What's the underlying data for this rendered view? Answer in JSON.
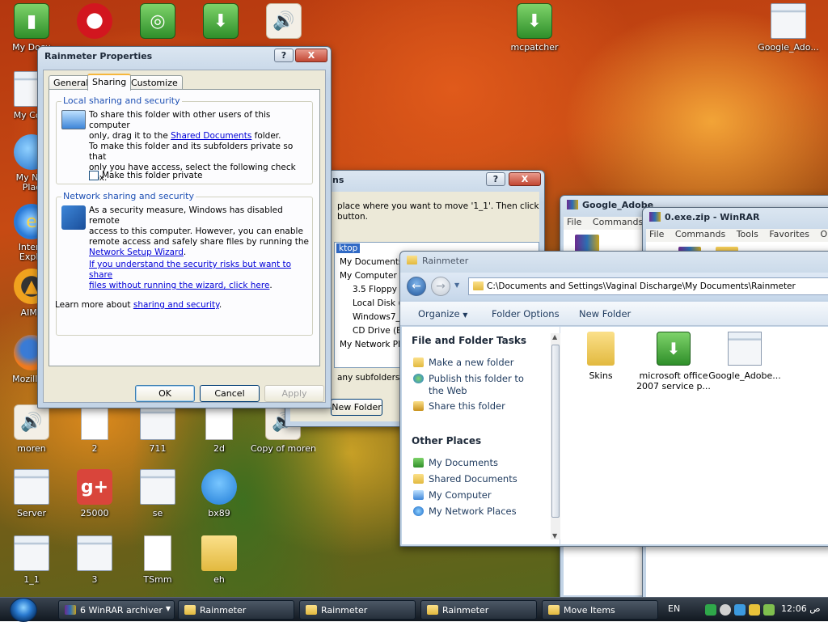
{
  "desktop_icons": [
    {
      "label": "My Docu",
      "icon": "green-book-icon"
    },
    {
      "label": "",
      "icon": "opera-icon"
    },
    {
      "label": "",
      "icon": "cd-installer-icon"
    },
    {
      "label": "",
      "icon": "green-package-icon"
    },
    {
      "label": "",
      "icon": "speaker-icon"
    },
    {
      "label": "mcpatcher",
      "icon": "green-package-icon"
    },
    {
      "label": "Google_Ado...",
      "icon": "window-icon"
    },
    {
      "label": "My Com",
      "icon": "computer-icon"
    },
    {
      "label": "My Net\nPlac",
      "icon": "network-places-icon"
    },
    {
      "label": "Intern\nExplo",
      "icon": "internet-explorer-icon"
    },
    {
      "label": "AIMP",
      "icon": "aimp-icon"
    },
    {
      "label": "Mozilla F",
      "icon": "firefox-icon"
    },
    {
      "label": "moren",
      "icon": "speaker-icon"
    },
    {
      "label": "2",
      "icon": "text-document-icon"
    },
    {
      "label": "711",
      "icon": "window-icon"
    },
    {
      "label": "2d",
      "icon": "shortcut-document-icon"
    },
    {
      "label": "Copy of moren",
      "icon": "speaker-icon"
    },
    {
      "label": "Server",
      "icon": "window-icon"
    },
    {
      "label": "25000",
      "icon": "google-plus-icon"
    },
    {
      "label": "se",
      "icon": "window-icon"
    },
    {
      "label": "bx89",
      "icon": "blue-bird-icon"
    },
    {
      "label": "1_1",
      "icon": "window-icon"
    },
    {
      "label": "3",
      "icon": "window-icon"
    },
    {
      "label": "TSmm",
      "icon": "document-icon"
    },
    {
      "label": "eh",
      "icon": "folder-icon"
    }
  ],
  "properties_dialog": {
    "title": "Rainmeter Properties",
    "help_btn": "?",
    "close_btn": "X",
    "tabs": [
      "General",
      "Sharing",
      "Customize"
    ],
    "active_tab": "Sharing",
    "local_group": {
      "title": "Local sharing and security",
      "text1_a": "To share this folder with other users of this computer",
      "text1_b": "only, drag it to the ",
      "text1_link": "Shared Documents",
      "text1_c": " folder.",
      "text2_a": "To make this folder and its subfolders private so that",
      "text2_b": "only you have access, select the following check box.",
      "checkbox_label": "Make this folder private",
      "checkbox_checked": false
    },
    "network_group": {
      "title": "Network sharing and security",
      "text_a": "As a security measure, Windows has disabled remote",
      "text_b": "access to this computer. However, you can enable",
      "text_c": "remote access and safely share files by running the",
      "text_link": "Network Setup Wizard",
      "text_link_end": ".",
      "risk_link_a": "If you understand the security risks but want to share",
      "risk_link_b": "files without running the wizard, click here",
      "risk_link_end": ".",
      "learn_prefix": "Learn more about ",
      "learn_link": "sharing and security",
      "learn_suffix": "."
    },
    "ok": "OK",
    "cancel": "Cancel",
    "apply": "Apply"
  },
  "move_dialog": {
    "title_fragment": "ns",
    "help_btn": "?",
    "close_btn": "X",
    "instr_a": "place where you want to move '1_1'. Then click",
    "instr_b": "button.",
    "tree_items": [
      "ktop",
      "My Documents",
      "My Computer",
      "3.5 Floppy (",
      "Local Disk (C",
      "Windows7_3",
      "CD Drive (E:",
      "My Network Plac"
    ],
    "footer_fragment": "any subfolders, cl",
    "new_folder_btn": "New Folder"
  },
  "winrar1": {
    "title": "Google_Adobe",
    "menu": [
      "File",
      "Commands"
    ]
  },
  "winrar2": {
    "title": "0.exe.zip - WinRAR",
    "menu": [
      "File",
      "Commands",
      "Tools",
      "Favorites",
      "Options"
    ]
  },
  "explorer": {
    "title": "Rainmeter",
    "address": "C:\\Documents and Settings\\Vaginal Discharge\\My Documents\\Rainmeter",
    "commands": [
      "Organize",
      "Folder Options",
      "New Folder"
    ],
    "tasks_header": "File and Folder Tasks",
    "tasks": [
      "Make a new folder",
      "Publish this folder to",
      "the Web",
      "Share this folder"
    ],
    "places_header": "Other Places",
    "places": [
      "My Documents",
      "Shared Documents",
      "My Computer",
      "My Network Places"
    ],
    "files": [
      {
        "name": "Skins",
        "icon": "folder-icon"
      },
      {
        "name": "microsoft office\n2007 service p...",
        "icon": "green-package-icon"
      },
      {
        "name": "Google_Adobe...",
        "icon": "window-icon"
      }
    ]
  },
  "taskbar": {
    "items": [
      {
        "label": "6 WinRAR archiver",
        "icon": "winrar-icon"
      },
      {
        "label": "Rainmeter",
        "icon": "folder-icon"
      },
      {
        "label": "Rainmeter",
        "icon": "folder-icon"
      },
      {
        "label": "Rainmeter",
        "icon": "folder-icon"
      },
      {
        "label": "Move Items",
        "icon": "folder-icon"
      }
    ],
    "language": "EN",
    "clock": "12:06 ص"
  }
}
